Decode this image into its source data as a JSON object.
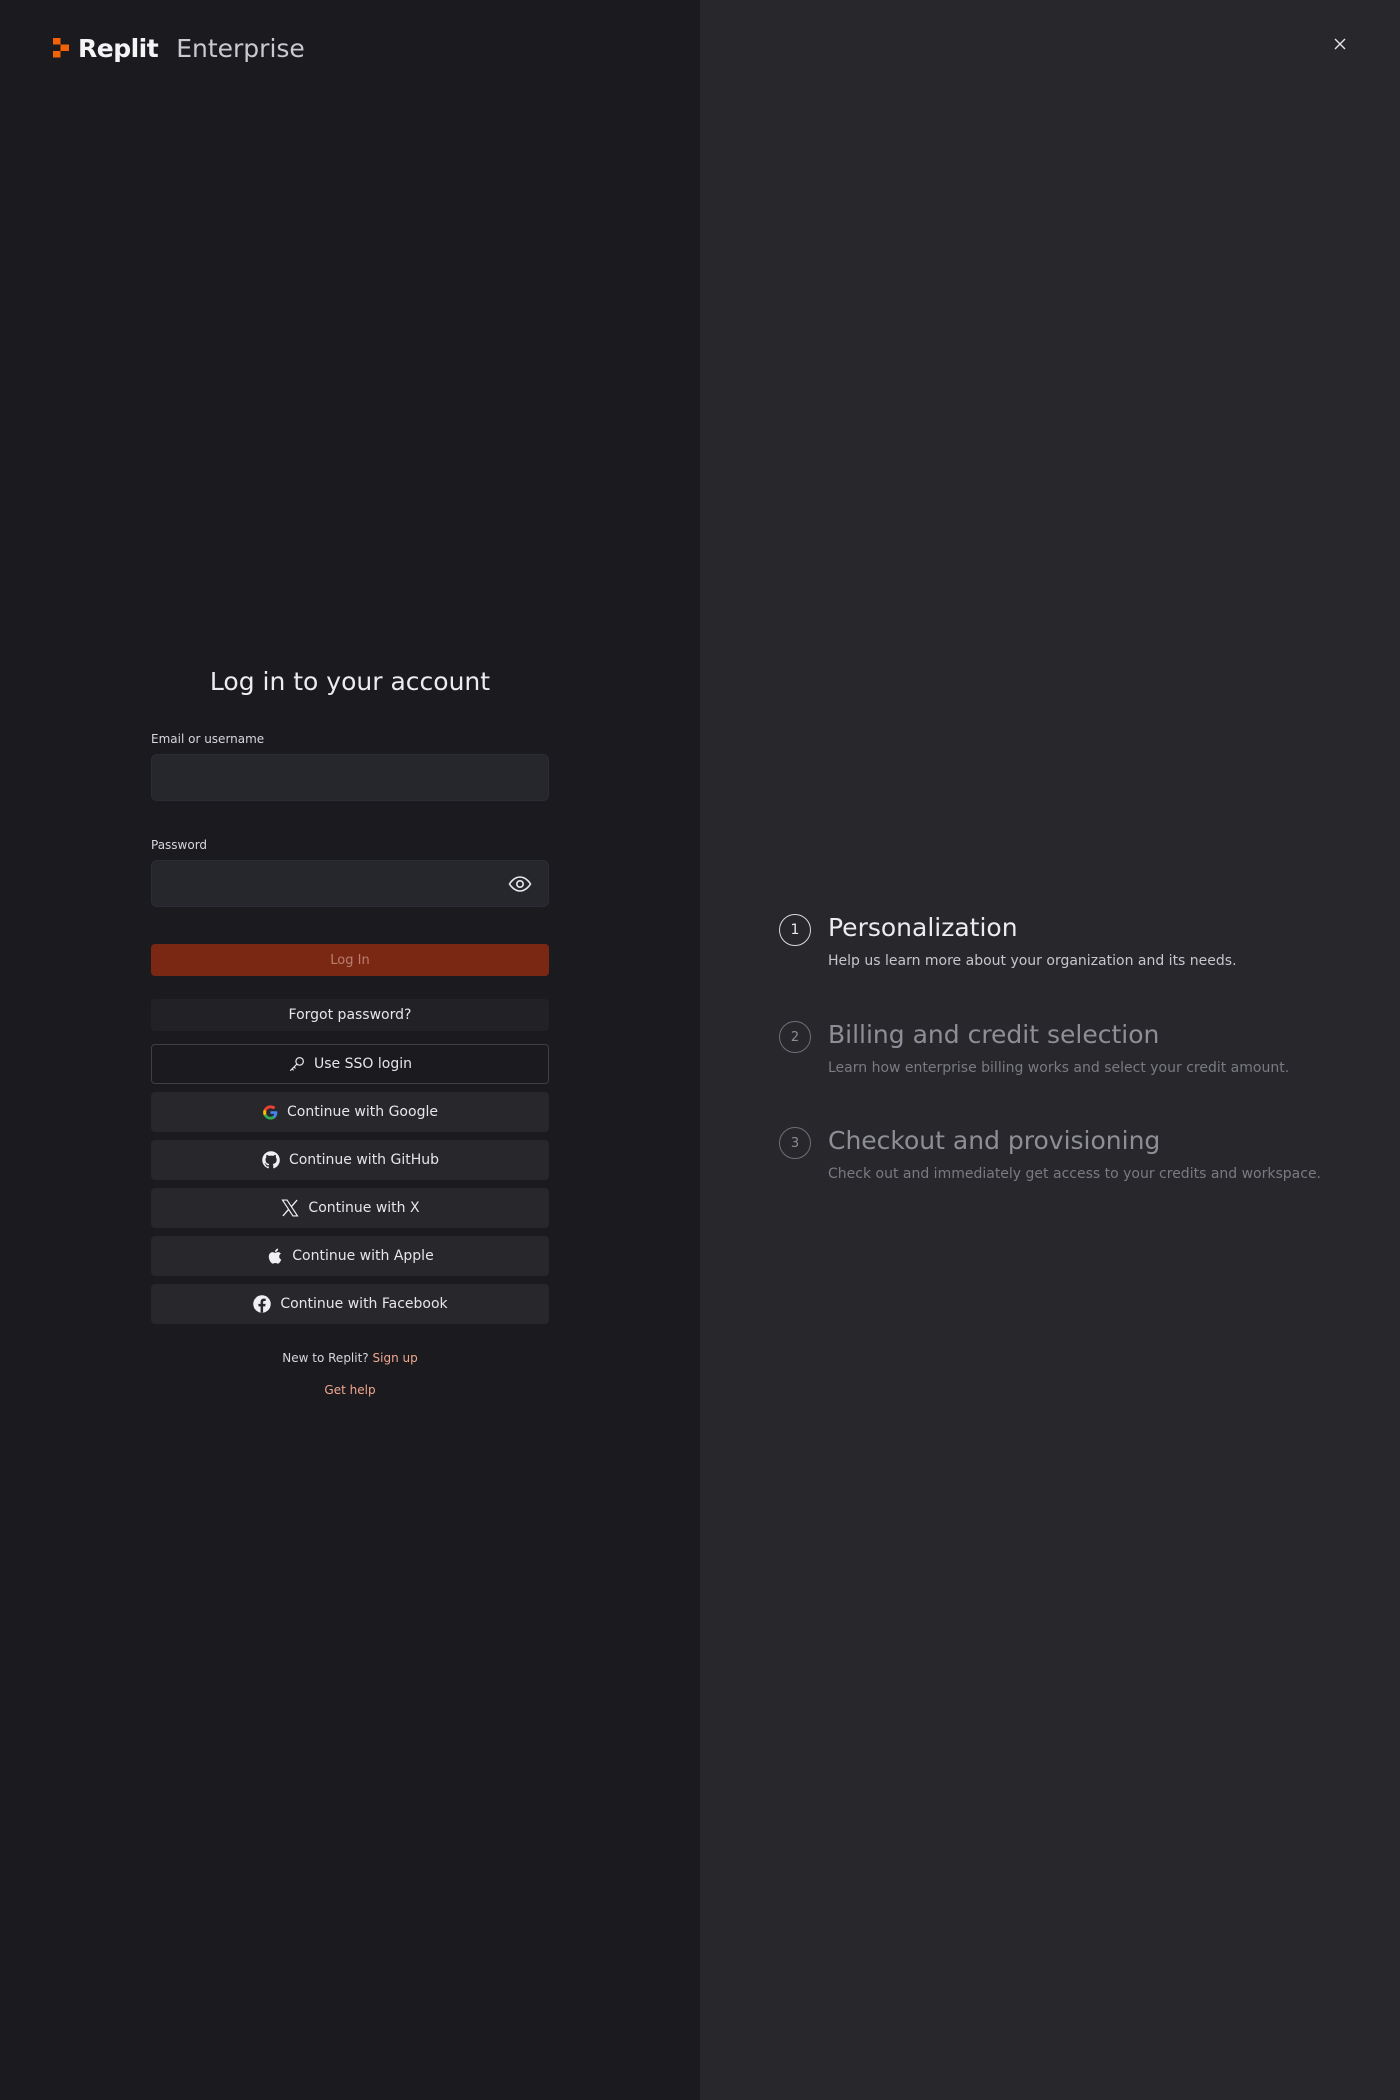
{
  "brand": {
    "name": "Replit",
    "product": "Enterprise",
    "accent": "#f26207"
  },
  "header": {
    "close_icon": "close-icon"
  },
  "login": {
    "title": "Log in to your account",
    "email_label": "Email or username",
    "email_value": "",
    "password_label": "Password",
    "password_value": "",
    "login_button": "Log In",
    "forgot_button": "Forgot password?",
    "providers": [
      {
        "label": "Use SSO login",
        "icon": "key-icon"
      },
      {
        "label": "Continue with Google",
        "icon": "google-icon"
      },
      {
        "label": "Continue with GitHub",
        "icon": "github-icon"
      },
      {
        "label": "Continue with X",
        "icon": "x-icon"
      },
      {
        "label": "Continue with Apple",
        "icon": "apple-icon"
      },
      {
        "label": "Continue with Facebook",
        "icon": "facebook-icon"
      }
    ],
    "signup_prompt": "New to Replit?",
    "signup_link": "Sign up",
    "help_link": "Get help"
  },
  "steps": [
    {
      "number": "1",
      "title": "Personalization",
      "description": "Help us learn more about your organization and its needs.",
      "active": true
    },
    {
      "number": "2",
      "title": "Billing and credit selection",
      "description": "Learn how enterprise billing works and select your credit amount.",
      "active": false
    },
    {
      "number": "3",
      "title": "Checkout and provisioning",
      "description": "Check out and immediately get access to your credits and workspace.",
      "active": false
    }
  ]
}
